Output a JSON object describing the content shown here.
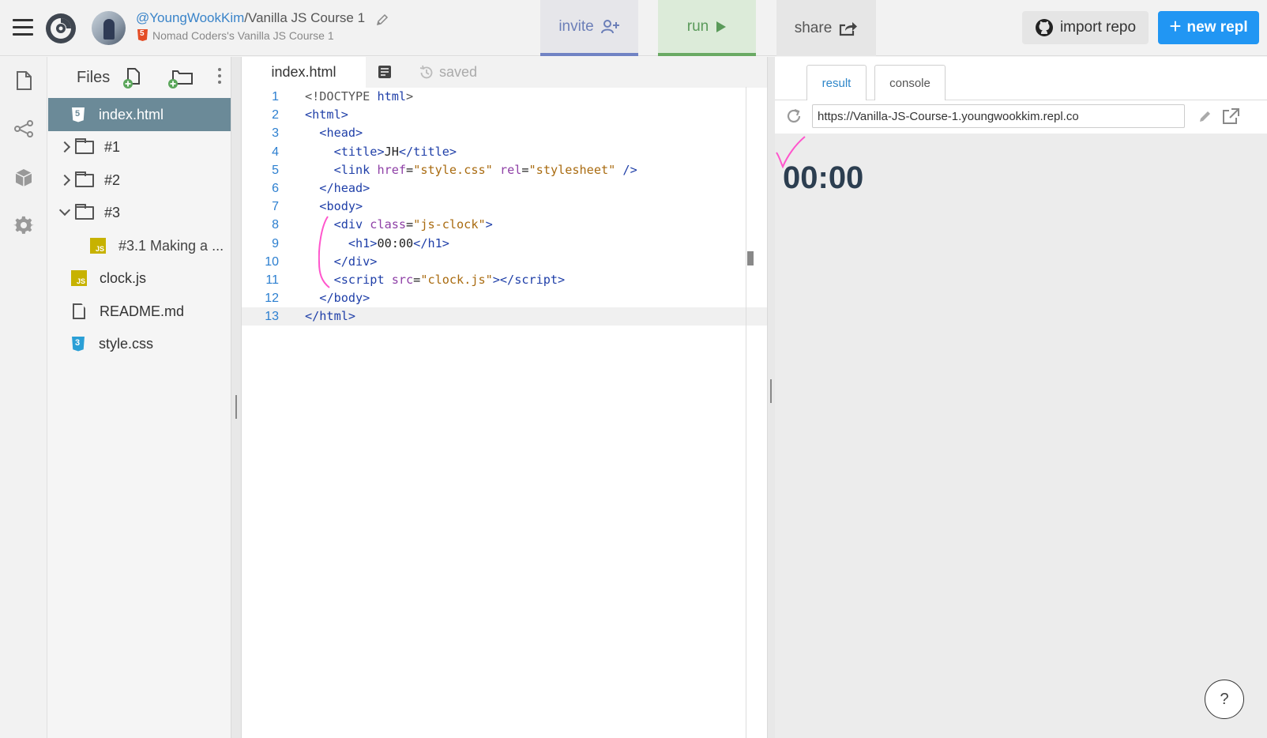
{
  "topbar": {
    "user": "@YoungWookKim",
    "separator": "/",
    "repl_name": "Vanilla JS Course 1",
    "subtitle": "Nomad Coders's Vanilla JS Course 1",
    "invite_label": "invite",
    "run_label": "run",
    "share_label": "share",
    "import_label": "import repo",
    "new_label": "new repl",
    "colors": {
      "invite": "#7183c4",
      "run": "#6aaa64",
      "new": "#2196f3"
    }
  },
  "rail": {
    "icons": [
      "files-icon",
      "version-control-icon",
      "packages-icon",
      "settings-icon"
    ]
  },
  "files": {
    "title": "Files",
    "items": [
      {
        "label": "index.html",
        "type": "html",
        "active": true
      },
      {
        "label": "#1",
        "type": "folder",
        "expanded": false
      },
      {
        "label": "#2",
        "type": "folder",
        "expanded": false
      },
      {
        "label": "#3",
        "type": "folder",
        "expanded": true
      },
      {
        "label": "#3.1 Making a ...",
        "type": "js"
      },
      {
        "label": "clock.js",
        "type": "js"
      },
      {
        "label": "README.md",
        "type": "doc"
      },
      {
        "label": "style.css",
        "type": "css"
      }
    ]
  },
  "editor": {
    "tab_label": "index.html",
    "saved_label": "saved",
    "line_numbers": [
      "1",
      "2",
      "3",
      "4",
      "5",
      "6",
      "7",
      "8",
      "9",
      "10",
      "11",
      "12",
      "13"
    ],
    "current_line": 13
  },
  "result": {
    "tab_result": "result",
    "tab_console": "console",
    "url": "https://Vanilla-JS-Course-1.youngwookkim.repl.co",
    "clock_text": "00:00"
  },
  "help_label": "?"
}
